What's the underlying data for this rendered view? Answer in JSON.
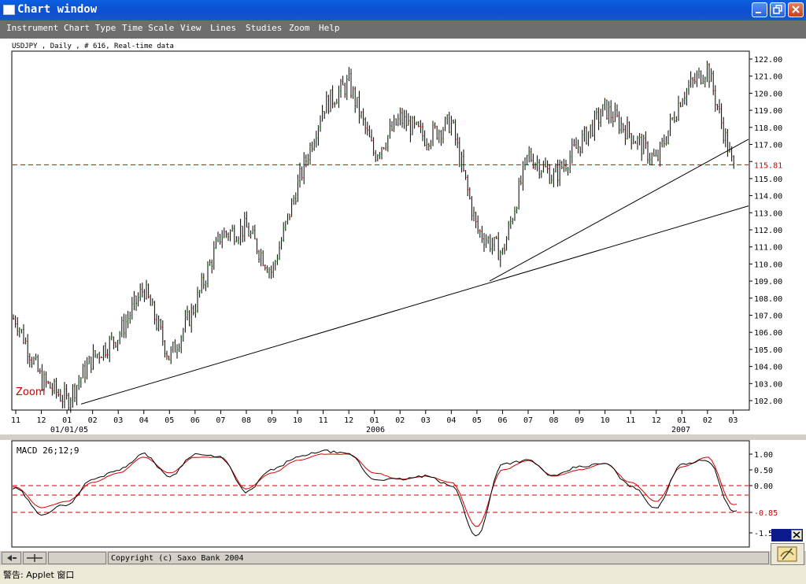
{
  "window": {
    "title": "Chart window"
  },
  "menu": [
    "Instrument",
    "Chart Type",
    "Time Scale",
    "View",
    "Lines",
    "Studies",
    "Zoom",
    "Help"
  ],
  "chart_header": "USDJPY , Daily , # 616, Real-time data",
  "price_axis": [
    "122.00",
    "121.00",
    "120.00",
    "119.00",
    "118.00",
    "117.00",
    "116.00",
    "115.00",
    "114.00",
    "113.00",
    "112.00",
    "111.00",
    "110.00",
    "109.00",
    "108.00",
    "107.00",
    "106.00",
    "105.00",
    "104.00",
    "103.00",
    "102.00"
  ],
  "current_price": "115.81",
  "zoom_label": "Zoom",
  "month_labels": [
    "11",
    "12",
    "01",
    "02",
    "03",
    "04",
    "05",
    "06",
    "07",
    "08",
    "09",
    "10",
    "11",
    "12",
    "01",
    "02",
    "03",
    "04",
    "05",
    "06",
    "07",
    "08",
    "09",
    "10",
    "11",
    "12",
    "01",
    "02",
    "03"
  ],
  "year_labels": [
    "01/01/05",
    "2006",
    "2007"
  ],
  "macd": {
    "title": "MACD 26;12;9",
    "axis": [
      "1.00",
      "0.50",
      "0.00",
      "-0.85",
      "-1.5"
    ]
  },
  "bottom": {
    "copyright": "Copyright (c) Saxo Bank 2004"
  },
  "status_text": "警告: Applet 窗口",
  "colors": {
    "up": "#00b000",
    "down": "#d00000",
    "bar": "#000000",
    "signal": "#d00000",
    "level": "#d00000"
  },
  "chart_data": {
    "type": "line",
    "title": "USDJPY , Daily , # 616, Real-time data",
    "xlabel": "",
    "ylabel": "",
    "ylim": [
      101.6,
      122.3
    ],
    "grid": false,
    "x": [
      "11",
      "12",
      "01/01/05",
      "02",
      "03",
      "04",
      "05",
      "06",
      "07",
      "08",
      "09",
      "10",
      "11",
      "12",
      "2006",
      "02",
      "03",
      "04",
      "05",
      "06",
      "07",
      "08",
      "09",
      "10",
      "11",
      "12",
      "2007",
      "02",
      "03"
    ],
    "series": [
      {
        "values": [
          106.8,
          103.2,
          102.0,
          104.5,
          105.8,
          108.6,
          104.5,
          107.6,
          111.7,
          112.1,
          109.5,
          114.6,
          119.2,
          120.6,
          116.4,
          118.5,
          117.4,
          118.3,
          112.0,
          110.6,
          116.4,
          115.1,
          117.0,
          119.1,
          117.6,
          116.0,
          119.9,
          121.5,
          115.6
        ]
      }
    ],
    "macd": {
      "title": "MACD 26;12;9",
      "ylim": [
        -1.75,
        1.3
      ],
      "axis_ticks": [
        1.0,
        0.5,
        0.0,
        -0.85,
        -1.5
      ],
      "levels": [
        0.0,
        -0.3,
        -0.85
      ],
      "macd": [
        -0.1,
        -0.9,
        -0.6,
        0.2,
        0.5,
        1.0,
        0.3,
        1.0,
        0.9,
        -0.2,
        0.5,
        0.9,
        1.1,
        1.0,
        0.2,
        0.2,
        0.3,
        0.0,
        -1.6,
        0.7,
        0.8,
        0.3,
        0.6,
        0.7,
        0.0,
        -0.7,
        0.7,
        0.8,
        -0.8
      ],
      "signal": [
        -0.05,
        -0.7,
        -0.5,
        0.1,
        0.4,
        0.9,
        0.4,
        0.9,
        0.9,
        -0.1,
        0.4,
        0.8,
        1.0,
        1.0,
        0.4,
        0.2,
        0.3,
        0.1,
        -1.3,
        0.5,
        0.8,
        0.3,
        0.5,
        0.7,
        0.1,
        -0.5,
        0.6,
        0.9,
        -0.6
      ]
    }
  }
}
